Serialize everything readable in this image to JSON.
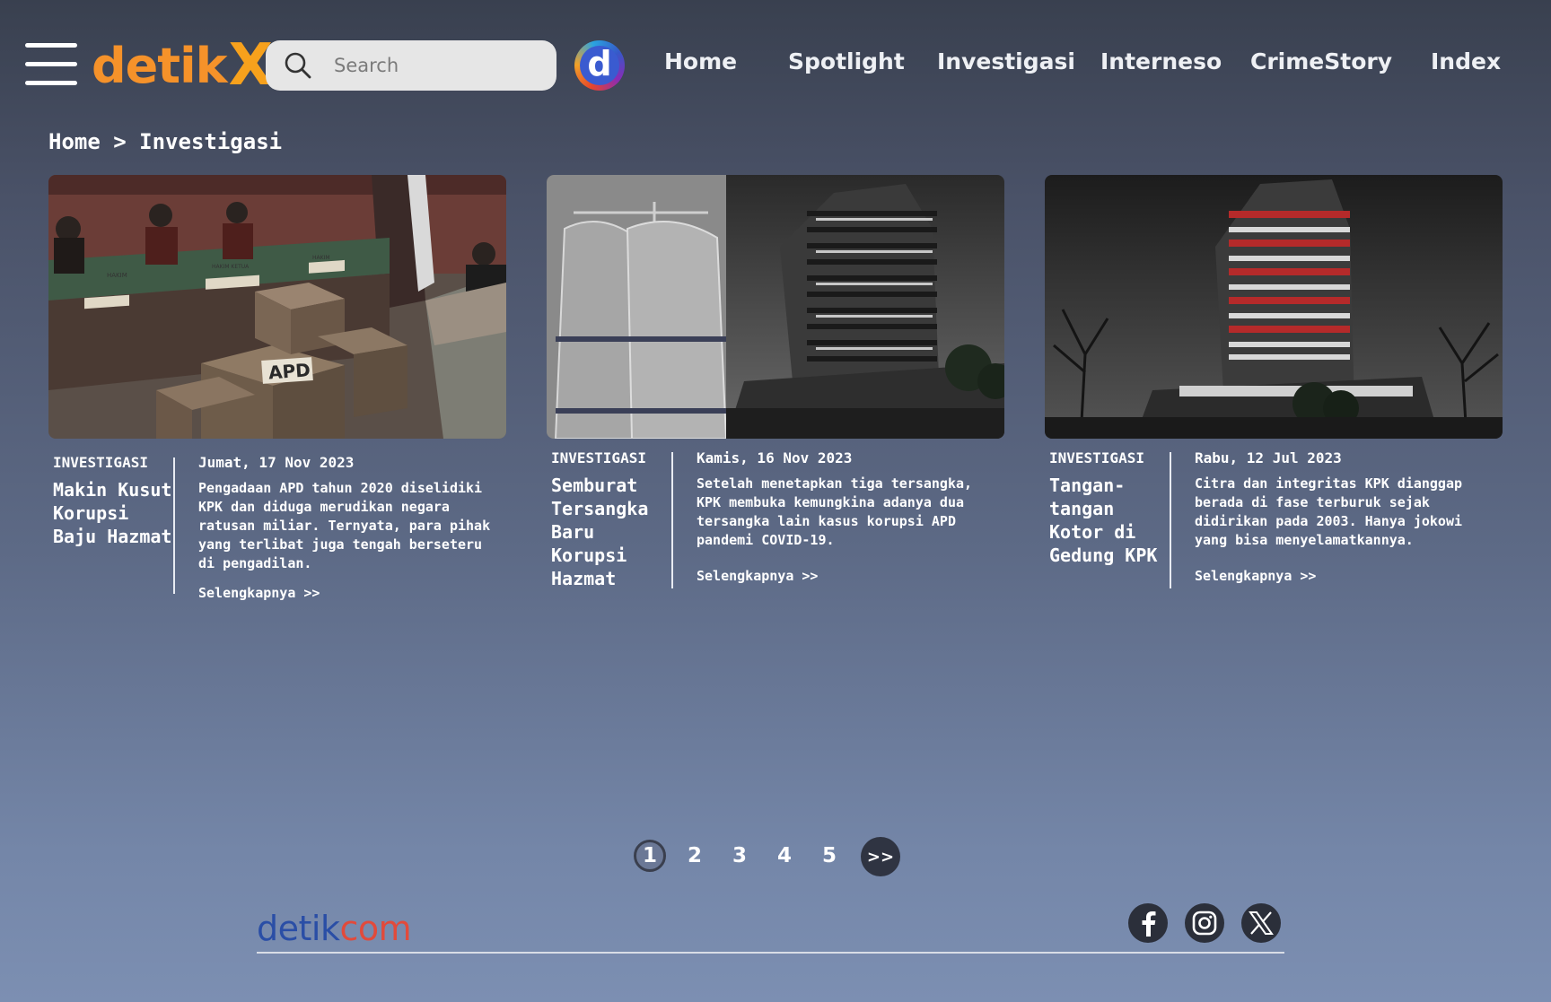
{
  "header": {
    "logo_text": "detik",
    "logo_accent": "X",
    "search_placeholder": "Search",
    "badge_letter": "d",
    "nav": [
      {
        "label": "Home"
      },
      {
        "label": "Spotlight"
      },
      {
        "label": "Investigasi"
      },
      {
        "label": "Interneso"
      },
      {
        "label": "CrimeStory"
      },
      {
        "label": "Index"
      }
    ]
  },
  "breadcrumb": "Home > Investigasi",
  "articles": [
    {
      "category": "INVESTIGASI",
      "title": "Makin Kusut Korupsi Baju Hazmat",
      "date": "Jumat, 17 Nov 2023",
      "description": "Pengadaan APD tahun 2020 diselidiki KPK dan diduga merudikan negara ratusan miliar. Ternyata, para pihak yang terlibat juga tengah berseteru di pengadilan.",
      "more": "Selengkapnya >>",
      "image_label": "APD",
      "image_desk_labels": [
        "HAKIM",
        "HAKIM KETUA",
        "HAKIM"
      ]
    },
    {
      "category": "INVESTIGASI",
      "title": "Semburat Tersangka Baru Korupsi Hazmat",
      "date": "Kamis, 16 Nov 2023",
      "description": "Setelah menetapkan tiga tersangka, KPK membuka kemungkina adanya dua tersangka lain kasus korupsi APD pandemi COVID-19.",
      "more": "Selengkapnya >>"
    },
    {
      "category": "INVESTIGASI",
      "title": "Tangan-tangan Kotor di Gedung KPK",
      "date": "Rabu, 12 Jul 2023",
      "description": "Citra dan integritas KPK dianggap berada di fase terburuk sejak didirikan pada 2003. Hanya jokowi yang bisa menyelamatkannya.",
      "more": "Selengkapnya >>"
    }
  ],
  "pagination": {
    "pages": [
      "1",
      "2",
      "3",
      "4",
      "5"
    ],
    "current": "1",
    "next_label": ">>"
  },
  "footer": {
    "logo_part1": "detik",
    "logo_part2": "com",
    "social": [
      "facebook-icon",
      "instagram-icon",
      "x-icon"
    ]
  },
  "colors": {
    "logo_orange": "#f5922a",
    "logo_x": "#f7a11c",
    "detikcom_blue": "#2a4ea6",
    "detikcom_red": "#e24a3b",
    "badge_blue": "#3a5bd0"
  }
}
